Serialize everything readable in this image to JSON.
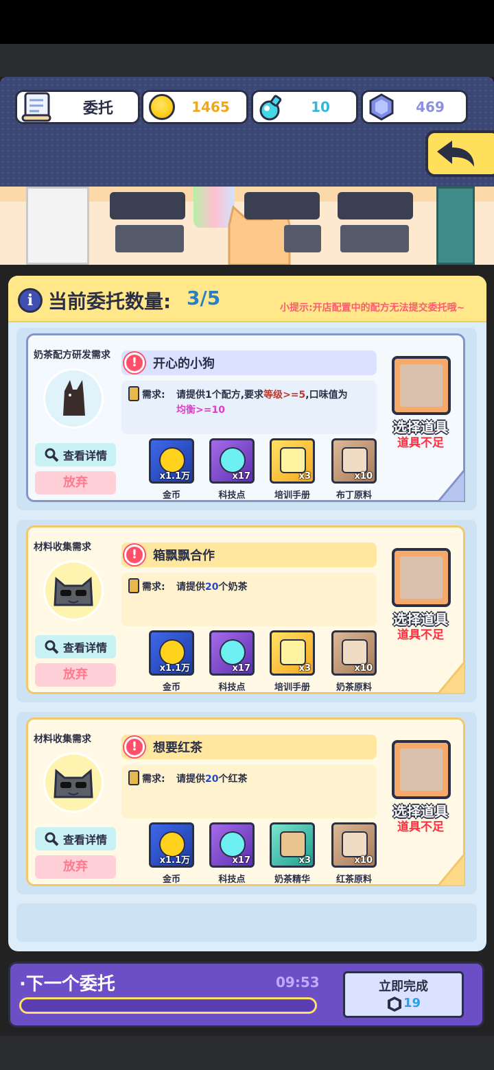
{
  "header": {
    "title": "委托",
    "coins": "1465",
    "tech_points": "10",
    "gems": "469"
  },
  "panel": {
    "count_label": "当前委托数量:",
    "count_value": "3/5",
    "tip": "小提示:开店配置中的配方无法提交委托哦~"
  },
  "cards": [
    {
      "type": "奶茶配方研发需求",
      "title": "开心的小狗",
      "req_label": "需求:",
      "req_text_parts": [
        "请提供1个配方,要求",
        "等级",
        ">=5",
        ",口味值为",
        "均衡>=10"
      ],
      "rewards": [
        {
          "name": "金币",
          "qty": "x1.1万",
          "icon": "coin-icon"
        },
        {
          "name": "科技点",
          "qty": "x17",
          "icon": "flask-icon"
        },
        {
          "name": "培训手册",
          "qty": "x3",
          "icon": "book-icon"
        },
        {
          "name": "布丁原料",
          "qty": "x10",
          "icon": "pudding-box-icon"
        }
      ],
      "detail_label": "查看详情",
      "quit_label": "放弃",
      "select_label": "选择道具",
      "insufficient_label": "道具不足"
    },
    {
      "type": "材料收集需求",
      "title": "箱飘飘合作",
      "req_label": "需求:",
      "req_text_parts": [
        "请提供",
        "20",
        "个奶茶"
      ],
      "rewards": [
        {
          "name": "金币",
          "qty": "x1.1万",
          "icon": "coin-icon"
        },
        {
          "name": "科技点",
          "qty": "x17",
          "icon": "flask-icon"
        },
        {
          "name": "培训手册",
          "qty": "x3",
          "icon": "book-icon"
        },
        {
          "name": "奶茶原料",
          "qty": "x10",
          "icon": "milk-tea-box-icon"
        }
      ],
      "detail_label": "查看详情",
      "quit_label": "放弃",
      "select_label": "选择道具",
      "insufficient_label": "道具不足"
    },
    {
      "type": "材料收集需求",
      "title": "想要红茶",
      "req_label": "需求:",
      "req_text_parts": [
        "请提供",
        "20",
        "个红茶"
      ],
      "rewards": [
        {
          "name": "金币",
          "qty": "x1.1万",
          "icon": "coin-icon"
        },
        {
          "name": "科技点",
          "qty": "x17",
          "icon": "flask-icon"
        },
        {
          "name": "奶茶精华",
          "qty": "x3",
          "icon": "essence-jar-icon"
        },
        {
          "name": "红茶原料",
          "qty": "x10",
          "icon": "red-tea-box-icon"
        }
      ],
      "detail_label": "查看详情",
      "quit_label": "放弃",
      "select_label": "选择道具",
      "insufficient_label": "道具不足"
    }
  ],
  "bottom": {
    "next_label": "·下一个委托",
    "timer": "09:53",
    "instant_label": "立即完成",
    "instant_cost": "19"
  },
  "colors": {
    "header_bg": "#3b4774",
    "panel_head": "#ffe78a",
    "bottom_bar": "#6c4ec7",
    "alert": "#ff4f6b"
  }
}
